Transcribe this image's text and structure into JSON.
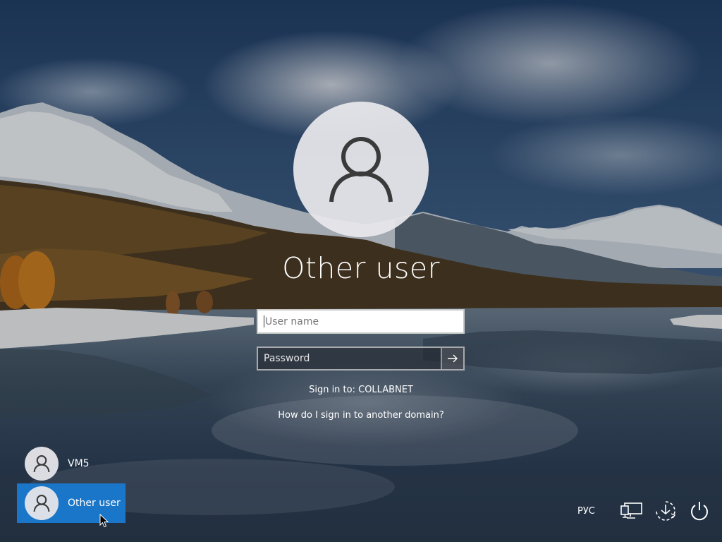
{
  "login": {
    "title": "Other user",
    "username_placeholder": "User name",
    "password_placeholder": "Password",
    "sign_in_to": "Sign in to: COLLABNET",
    "domain_help_link": "How do I sign in to another domain?"
  },
  "users": [
    {
      "name": "VM5",
      "selected": false
    },
    {
      "name": "Other user",
      "selected": true
    }
  ],
  "tray": {
    "language": "РУС",
    "icons": [
      "network-icon",
      "ease-of-access-icon",
      "power-icon"
    ]
  },
  "colors": {
    "selected_tile": "#1a76c8"
  }
}
